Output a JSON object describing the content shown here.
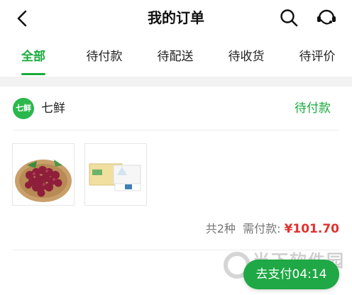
{
  "header": {
    "title": "我的订单",
    "back_icon": "back-arrow-icon",
    "search_icon": "search-icon",
    "service_icon": "customer-service-icon"
  },
  "tabs": [
    {
      "label": "全部",
      "active": true
    },
    {
      "label": "待付款",
      "active": false
    },
    {
      "label": "待配送",
      "active": false
    },
    {
      "label": "待收货",
      "active": false
    },
    {
      "label": "待评价",
      "active": false
    }
  ],
  "order": {
    "store_logo_text": "七鲜",
    "store_name": "七鲜",
    "status": "待付款",
    "items": [
      {
        "image": "grapes-product-image"
      },
      {
        "image": "tissue-paper-product-image"
      }
    ],
    "count_text": "共2种",
    "need_pay_label": "需付款:",
    "amount": "¥101.70",
    "pay_button": "去支付04:14"
  },
  "watermark": "当下软件园",
  "colors": {
    "accent": "#1aab3c",
    "price": "#e0322f",
    "button": "#1fa845"
  }
}
